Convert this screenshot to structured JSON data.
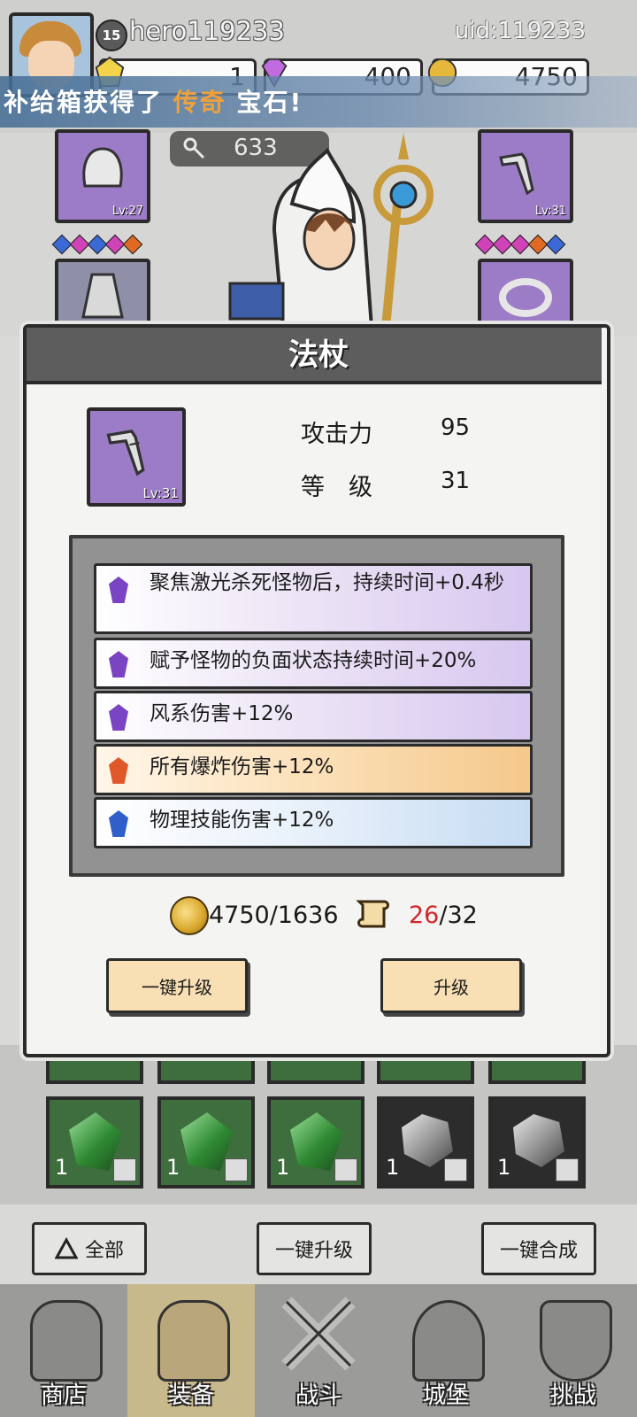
{
  "header": {
    "level": "15",
    "username": "hero119233",
    "uid": "uid:119233",
    "resources": {
      "gems_yellow": "1",
      "gems_purple": "400",
      "gold": "4750"
    },
    "broadcast": {
      "prefix": "补给箱获得了",
      "highlight": "传奇",
      "suffix": "宝石!"
    }
  },
  "scene": {
    "key_count": "633",
    "left_slot_level": "Lv:27",
    "right_slot_level": "Lv:31"
  },
  "dialog": {
    "title": "法杖",
    "item_level": "Lv:31",
    "stats": [
      {
        "label": "攻击力",
        "value": "95"
      },
      {
        "label": "等　级",
        "value": "31"
      }
    ],
    "affixes": [
      {
        "text": "聚焦激光杀死怪物后，持续时间+0.4秒",
        "rarity": "purple"
      },
      {
        "text": "赋予怪物的负面状态持续时间+20%",
        "rarity": "purple"
      },
      {
        "text": "风系伤害+12%",
        "rarity": "purple"
      },
      {
        "text": "所有爆炸伤害+12%",
        "rarity": "orange"
      },
      {
        "text": "物理技能伤害+12%",
        "rarity": "blue"
      }
    ],
    "cost": {
      "gold": "4750/1636",
      "scroll_have": "26",
      "scroll_need": "/32"
    },
    "buttons": {
      "auto_upgrade": "一键升级",
      "upgrade": "升级"
    }
  },
  "inventory": {
    "items": [
      {
        "count": "1",
        "kind": "green-crystal"
      },
      {
        "count": "1",
        "kind": "green-crystal"
      },
      {
        "count": "1",
        "kind": "green-crystal"
      },
      {
        "count": "1",
        "kind": "grey-stone"
      },
      {
        "count": "1",
        "kind": "grey-stone"
      }
    ]
  },
  "actions": {
    "filter": "全部",
    "auto_upgrade": "一键升级",
    "auto_merge": "一键合成"
  },
  "nav": [
    {
      "label": "商店",
      "icon": "shop-icon"
    },
    {
      "label": "装备",
      "icon": "backpack-icon"
    },
    {
      "label": "战斗",
      "icon": "swords-icon"
    },
    {
      "label": "城堡",
      "icon": "castle-icon"
    },
    {
      "label": "挑战",
      "icon": "shield-icon"
    }
  ],
  "colors": {
    "accent_orange": "#f0a03a",
    "scroll_red": "#d2262b",
    "purple_slot": "#9d7cc7"
  }
}
